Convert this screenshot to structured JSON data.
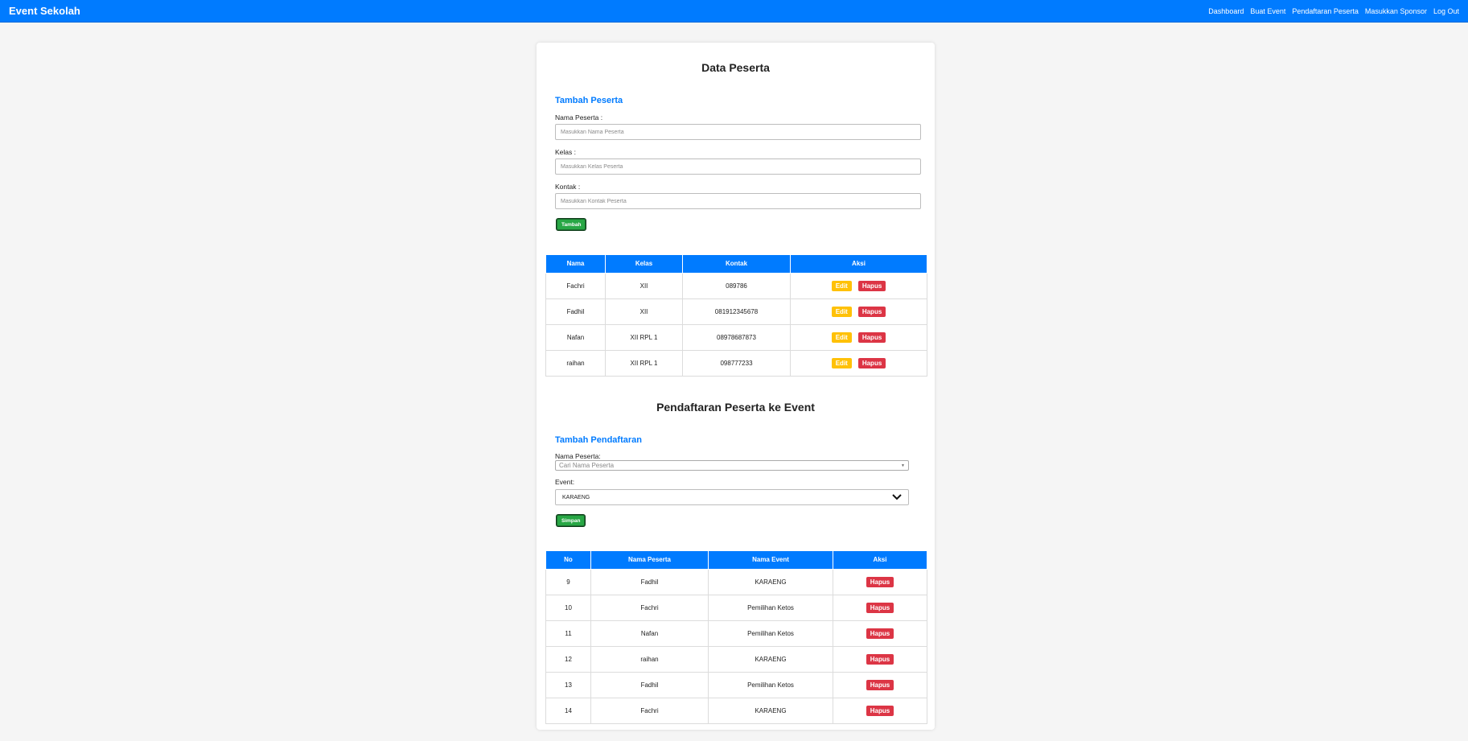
{
  "navbar": {
    "brand": "Event Sekolah",
    "links": [
      "Dashboard",
      "Buat Event",
      "Pendaftaran Peserta",
      "Masukkan Sponsor",
      "Log Out"
    ]
  },
  "peserta": {
    "title": "Data Peserta",
    "form_title": "Tambah Peserta",
    "nama_label": "Nama Peserta :",
    "nama_placeholder": "Masukkan Nama Peserta",
    "kelas_label": "Kelas :",
    "kelas_placeholder": "Masukkan Kelas Peserta",
    "kontak_label": "Kontak :",
    "kontak_placeholder": "Masukkan Kontak Peserta",
    "submit_label": "Tambah",
    "columns": [
      "Nama",
      "Kelas",
      "Kontak",
      "Aksi"
    ],
    "rows": [
      {
        "nama": "Fachri",
        "kelas": "XII",
        "kontak": "089786"
      },
      {
        "nama": "Fadhil",
        "kelas": "XII",
        "kontak": "081912345678"
      },
      {
        "nama": "Nafan",
        "kelas": "XII RPL 1",
        "kontak": "08978687873"
      },
      {
        "nama": "raihan",
        "kelas": "XII RPL 1",
        "kontak": "098777233"
      }
    ],
    "edit_label": "Edit",
    "hapus_label": "Hapus"
  },
  "pendaftaran": {
    "title": "Pendaftaran Peserta ke Event",
    "form_title": "Tambah Pendaftaran",
    "nama_label": "Nama Peserta:",
    "nama_placeholder": "Cari Nama Peserta",
    "event_label": "Event:",
    "event_selected": "KARAENG",
    "submit_label": "Simpan",
    "columns": [
      "No",
      "Nama Peserta",
      "Nama Event",
      "Aksi"
    ],
    "rows": [
      {
        "no": "9",
        "nama": "Fadhil",
        "event": "KARAENG"
      },
      {
        "no": "10",
        "nama": "Fachri",
        "event": "Pemilihan Ketos"
      },
      {
        "no": "11",
        "nama": "Nafan",
        "event": "Pemilihan Ketos"
      },
      {
        "no": "12",
        "nama": "raihan",
        "event": "KARAENG"
      },
      {
        "no": "13",
        "nama": "Fadhil",
        "event": "Pemilihan Ketos"
      },
      {
        "no": "14",
        "nama": "Fachri",
        "event": "KARAENG"
      }
    ],
    "hapus_label": "Hapus"
  },
  "colors": {
    "primary": "#007bff",
    "success": "#28a745",
    "warning": "#ffc107",
    "danger": "#dc3545"
  }
}
